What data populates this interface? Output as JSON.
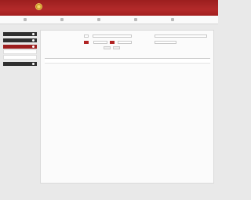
{
  "banner": {
    "title": "",
    "subtitle": ""
  },
  "nav": {
    "items": [
      {
        "label": ""
      },
      {
        "label": ""
      },
      {
        "label": ""
      },
      {
        "label": ""
      },
      {
        "label": ""
      }
    ]
  },
  "breadcrumb": "",
  "sidebar": {
    "sections": [
      {
        "label": ""
      },
      {
        "label": ""
      },
      {
        "label": ""
      },
      {
        "label": ""
      }
    ],
    "subitems": [
      {
        "label": ""
      },
      {
        "label": ""
      }
    ]
  },
  "filters": {
    "label_1": "",
    "label_2": "",
    "label_3": "",
    "label_4": "",
    "select_1": "",
    "select_2": "",
    "select_3": "",
    "select_4": "",
    "select_5": "",
    "red_button_1": "",
    "red_button_2": "",
    "query_button": "",
    "reset_button": ""
  },
  "table": {
    "columns": [
      "",
      "",
      "",
      "",
      "",
      ""
    ],
    "rows": [
      [
        "",
        "",
        "",
        "",
        "",
        ""
      ]
    ]
  },
  "colors": {
    "brand": "#9c1e1e",
    "sidebar_dark": "#2f2f2f"
  }
}
